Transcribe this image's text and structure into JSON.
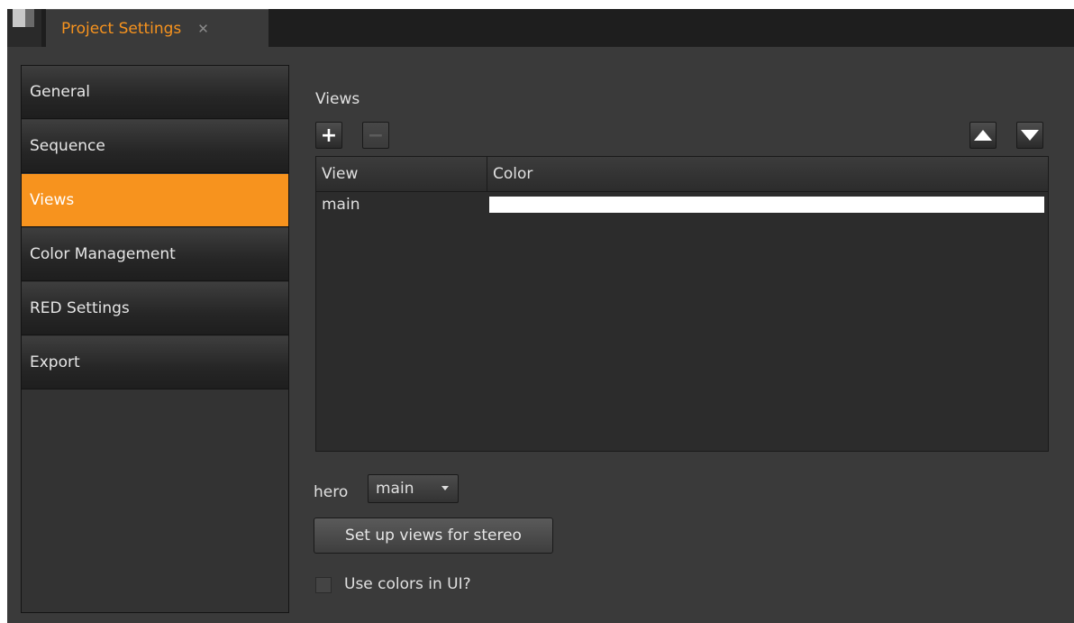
{
  "tab": {
    "title": "Project Settings",
    "close_glyph": "✕"
  },
  "sidebar": {
    "items": [
      {
        "label": "General",
        "active": false
      },
      {
        "label": "Sequence",
        "active": false
      },
      {
        "label": "Views",
        "active": true
      },
      {
        "label": "Color Management",
        "active": false
      },
      {
        "label": "RED Settings",
        "active": false
      },
      {
        "label": "Export",
        "active": false
      }
    ]
  },
  "views": {
    "section_label": "Views",
    "add_icon": "+",
    "remove_icon": "−",
    "table": {
      "columns": [
        "View",
        "Color"
      ],
      "rows": [
        {
          "view": "main",
          "color": "#ffffff"
        }
      ]
    },
    "hero": {
      "label": "hero",
      "selected": "main"
    },
    "stereo_button": "Set up views for stereo",
    "use_colors": {
      "label": "Use colors in UI?",
      "checked": false
    }
  },
  "colors": {
    "accent": "#f7931e",
    "panel": "#3a3a3a",
    "sidebar": "#333333"
  }
}
